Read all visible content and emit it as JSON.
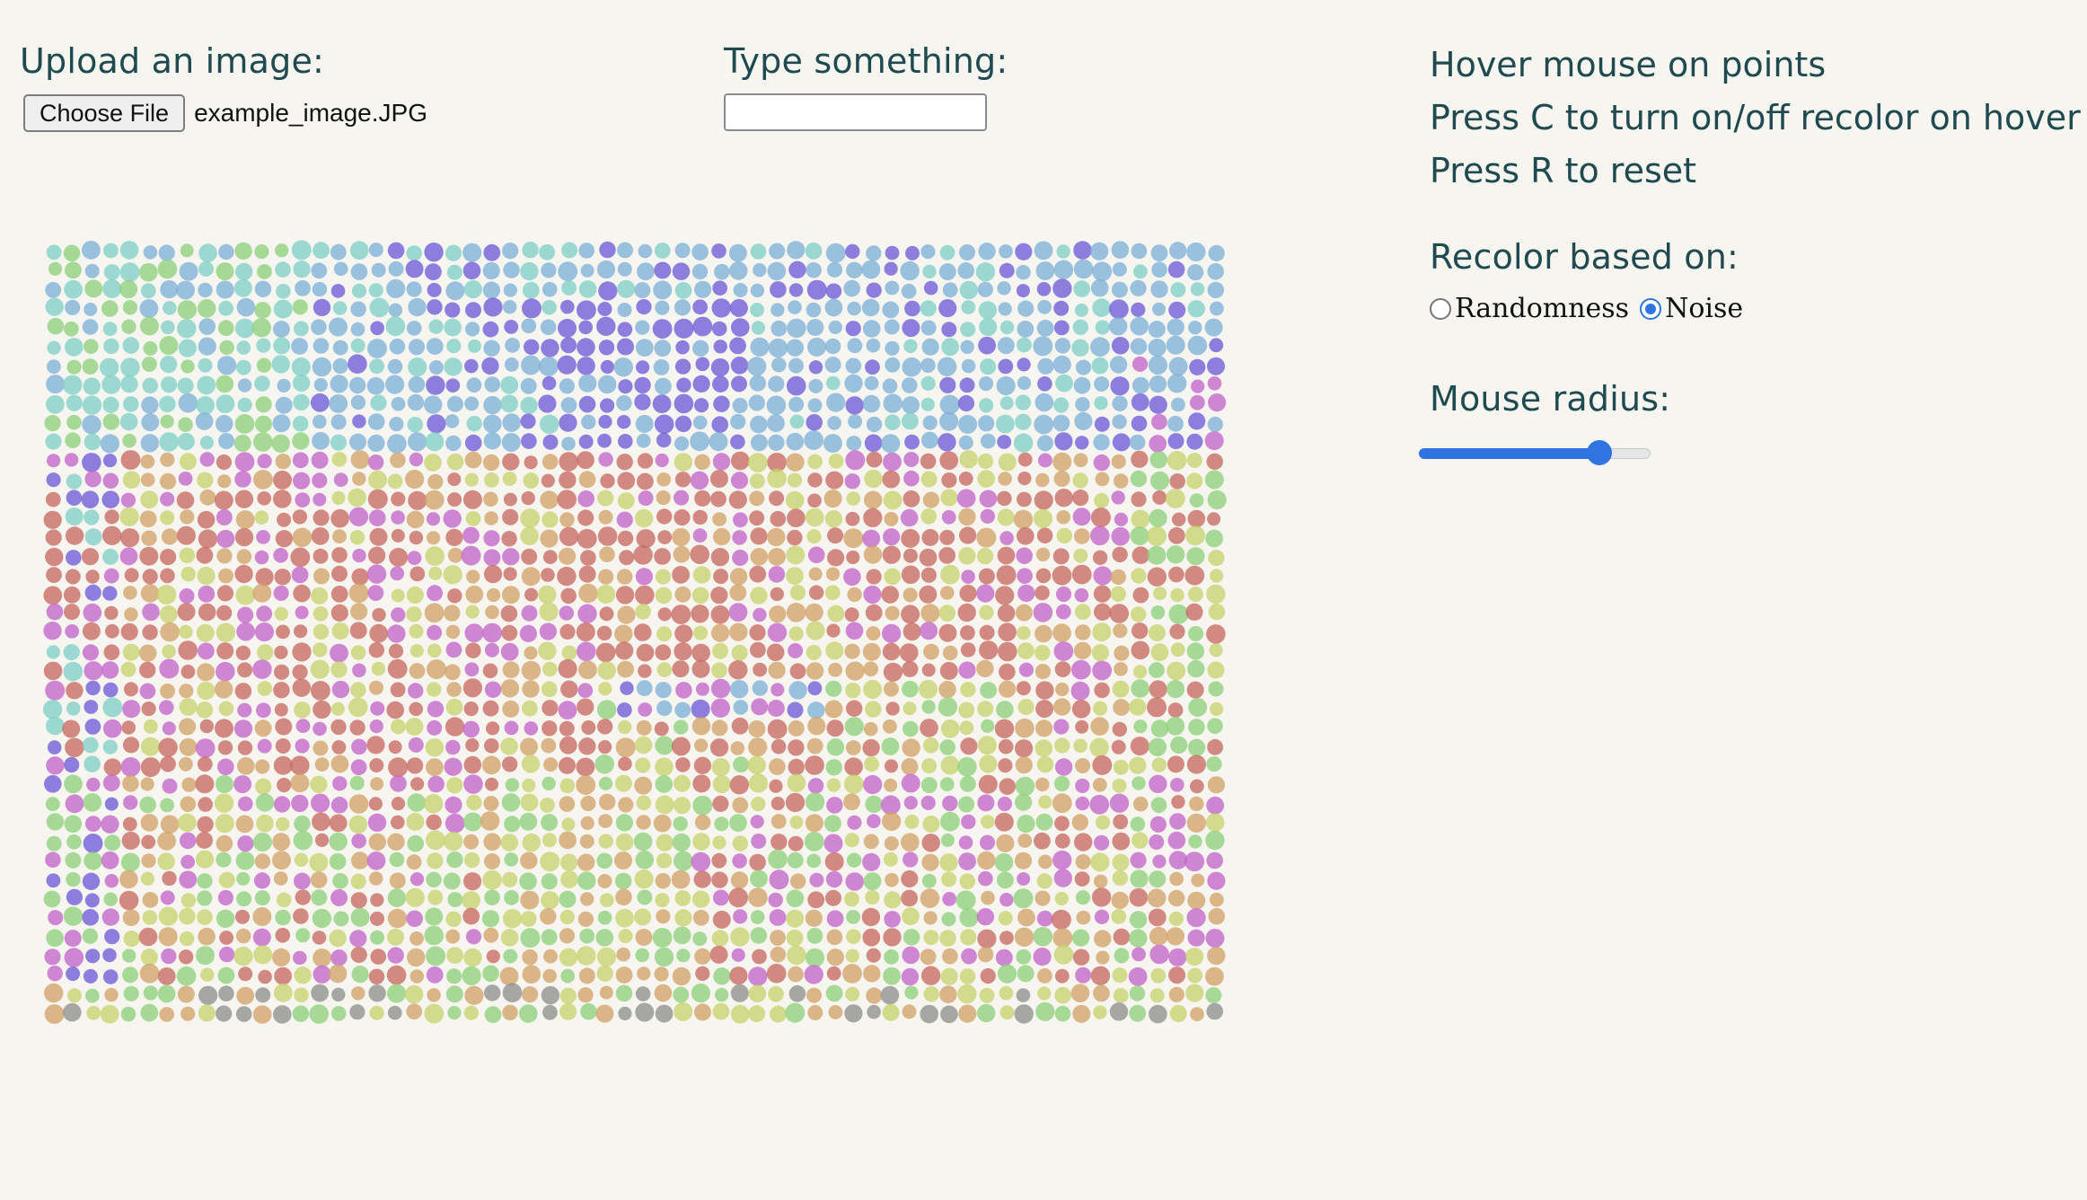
{
  "upload": {
    "label": "Upload an image:",
    "button_label": "Choose File",
    "file_name": "example_image.JPG"
  },
  "text": {
    "label": "Type something:",
    "value": ""
  },
  "instructions": [
    "Hover mouse on points",
    "Press C to turn on/off recolor on hover",
    "Press R to reset"
  ],
  "recolor": {
    "label": "Recolor based on:",
    "options": [
      {
        "label": "Randomness",
        "checked": false
      },
      {
        "label": "Noise",
        "checked": true
      }
    ]
  },
  "mouse_radius": {
    "label": "Mouse radius:",
    "value_fraction": 0.78
  },
  "palette": {
    "sky_blue": "#7fb1d6",
    "teal": "#82d1c6",
    "green": "#8fd17c",
    "yellow_green": "#c8d46e",
    "terracotta": "#c76a62",
    "magenta": "#c466c9",
    "violet": "#6f5bd6",
    "sand": "#d2a36a",
    "grey": "#8f8f8f",
    "accent": "#2f74e0"
  }
}
